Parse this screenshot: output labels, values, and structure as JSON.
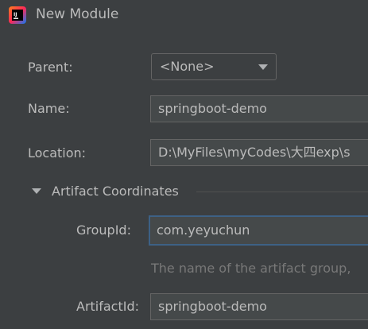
{
  "window": {
    "title": "New Module",
    "icon": "intellij-idea-icon"
  },
  "form": {
    "parent": {
      "label": "Parent:",
      "value": "<None>"
    },
    "name": {
      "label": "Name:",
      "value": "springboot-demo"
    },
    "location": {
      "label": "Location:",
      "value": "D:\\MyFiles\\myCodes\\大四exp\\s"
    }
  },
  "artifact_section": {
    "title": "Artifact Coordinates",
    "expanded": true,
    "group_id": {
      "label": "GroupId:",
      "value": "com.yeyuchun",
      "hint": "The name of the artifact group,"
    },
    "artifact_id": {
      "label": "ArtifactId:",
      "value": "springboot-demo"
    }
  },
  "colors": {
    "background": "#3c3f41",
    "field_bg": "#45494a",
    "focus_border": "#3d6185",
    "text": "#bbbbbb",
    "hint": "#787878"
  }
}
